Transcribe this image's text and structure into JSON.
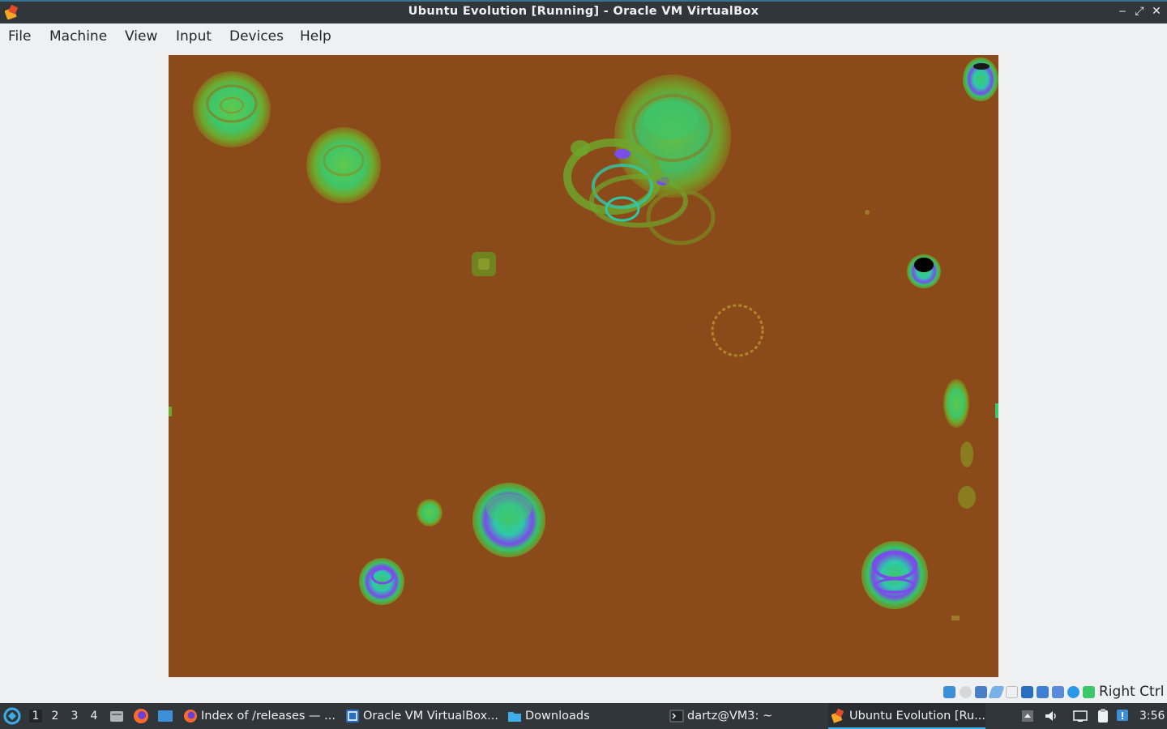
{
  "window": {
    "title": "Ubuntu Evolution [Running] - Oracle VM VirtualBox",
    "app_icon": "virtualbox-icon",
    "controls": {
      "minimize": "‒",
      "maximize": "⤢",
      "close": "✕"
    }
  },
  "menubar": {
    "items": [
      {
        "label": "File"
      },
      {
        "label": "Machine"
      },
      {
        "label": "View"
      },
      {
        "label": "Input"
      },
      {
        "label": "Devices"
      },
      {
        "label": "Help"
      }
    ]
  },
  "vm_display": {
    "background_color": "#8b4a1a"
  },
  "statusbar": {
    "icons": [
      "hard-disk-icon",
      "optical-drive-icon",
      "audio-icon",
      "network-icon",
      "usb-icon",
      "shared-folders-icon",
      "display-icon",
      "video-capture-icon",
      "cpu-icon",
      "mouse-integration-icon",
      "keyboard-icon"
    ],
    "host_key": "Right Ctrl"
  },
  "taskbar": {
    "workspaces": [
      "1",
      "2",
      "3",
      "4"
    ],
    "tasks": [
      {
        "label": "Index of /releases — ...",
        "icon": "firefox-icon"
      },
      {
        "label": "Oracle VM VirtualBox...",
        "icon": "virtualbox-manager-icon"
      },
      {
        "label": "Downloads",
        "icon": "folder-icon"
      },
      {
        "label": "dartz@VM3: ~",
        "icon": "terminal-icon"
      },
      {
        "label": "Ubuntu Evolution [Ru...",
        "icon": "virtualbox-icon"
      }
    ],
    "clock": "3:56"
  }
}
